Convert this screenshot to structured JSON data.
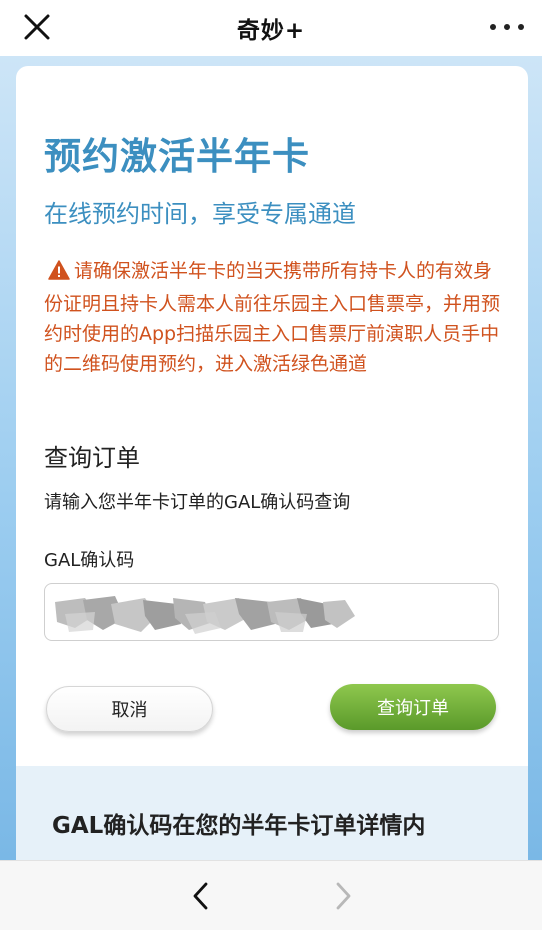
{
  "topbar": {
    "title": "奇妙+",
    "close_icon": "close-icon",
    "more_icon": "more-dots-icon"
  },
  "card": {
    "title": "预约激活半年卡",
    "subtitle": "在线预约时间，享受专属通道",
    "warning_icon": "warning-triangle-icon",
    "warning_text": "请确保激活半年卡的当天携带所有持卡人的有效身份证明且持卡人需本人前往乐园主入口售票亭，并用预约时使用的App扫描乐园主入口售票厅前演职人员手中的二维码使用预约，进入激活绿色通道",
    "section_title": "查询订单",
    "section_desc": "请输入您半年卡订单的GAL确认码查询",
    "field_label": "GAL确认码",
    "field_value": "",
    "cancel_label": "取消",
    "query_label": "查询订单"
  },
  "info_panel": {
    "text": "GAL确认码在您的半年卡订单详情内"
  },
  "bottombar": {
    "back_icon": "chevron-left-icon",
    "forward_icon": "chevron-right-icon"
  },
  "colors": {
    "title_blue": "#3c8fc0",
    "warning_orange": "#d0521e",
    "query_green": "#6aab35",
    "page_blue": "#9ccdf0"
  }
}
